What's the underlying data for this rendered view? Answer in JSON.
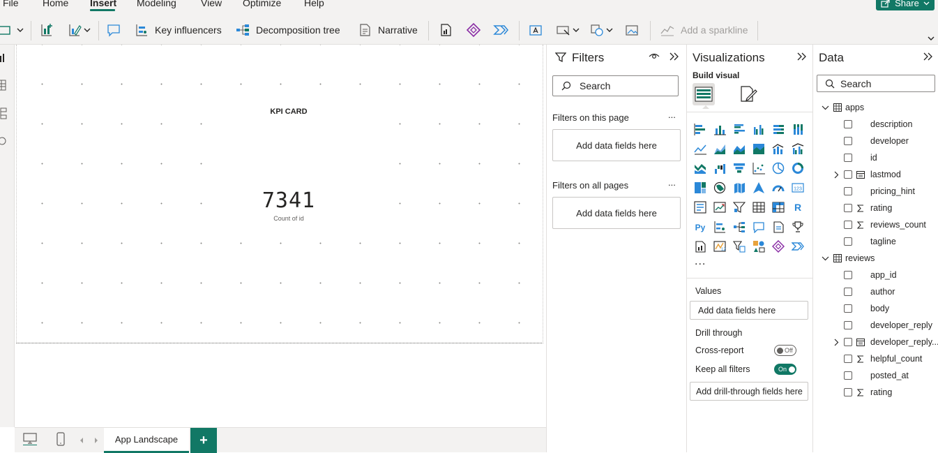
{
  "menu": {
    "items": [
      "File",
      "Home",
      "Insert",
      "Modeling",
      "View",
      "Optimize",
      "Help"
    ],
    "active": "Insert",
    "share_label": "Share"
  },
  "ribbon": {
    "key_influencers": "Key influencers",
    "decomposition_tree": "Decomposition tree",
    "narrative": "Narrative",
    "add_sparkline": "Add a sparkline"
  },
  "canvas": {
    "kpi_title": "KPI CARD",
    "kpi_value": "7341",
    "kpi_label": "Count of id"
  },
  "bottom": {
    "page_tab": "App Landscape",
    "add_page": "+"
  },
  "filters": {
    "title": "Filters",
    "search_placeholder": "Search",
    "on_this_page": "Filters on this page",
    "on_all_pages": "Filters on all pages",
    "add_fields": "Add data fields here",
    "more": "..."
  },
  "visualizations": {
    "title": "Visualizations",
    "build_visual": "Build visual",
    "more": "...",
    "values_label": "Values",
    "values_well": "Add data fields here",
    "drill_through": "Drill through",
    "cross_report": "Cross-report",
    "cross_report_state": "Off",
    "keep_all_filters": "Keep all filters",
    "keep_all_filters_state": "On",
    "drill_well": "Add drill-through fields here",
    "accent": "#117865"
  },
  "data_pane": {
    "title": "Data",
    "search_placeholder": "Search",
    "tables": [
      {
        "name": "apps",
        "fields": [
          {
            "name": "description",
            "kind": "text"
          },
          {
            "name": "developer",
            "kind": "text"
          },
          {
            "name": "id",
            "kind": "text"
          },
          {
            "name": "lastmod",
            "kind": "date"
          },
          {
            "name": "pricing_hint",
            "kind": "text"
          },
          {
            "name": "rating",
            "kind": "sum"
          },
          {
            "name": "reviews_count",
            "kind": "sum"
          },
          {
            "name": "tagline",
            "kind": "text"
          }
        ]
      },
      {
        "name": "reviews",
        "fields": [
          {
            "name": "app_id",
            "kind": "text"
          },
          {
            "name": "author",
            "kind": "text"
          },
          {
            "name": "body",
            "kind": "text"
          },
          {
            "name": "developer_reply",
            "kind": "text"
          },
          {
            "name": "developer_reply...",
            "kind": "date"
          },
          {
            "name": "helpful_count",
            "kind": "sum"
          },
          {
            "name": "posted_at",
            "kind": "text"
          },
          {
            "name": "rating",
            "kind": "sum"
          }
        ]
      }
    ]
  }
}
